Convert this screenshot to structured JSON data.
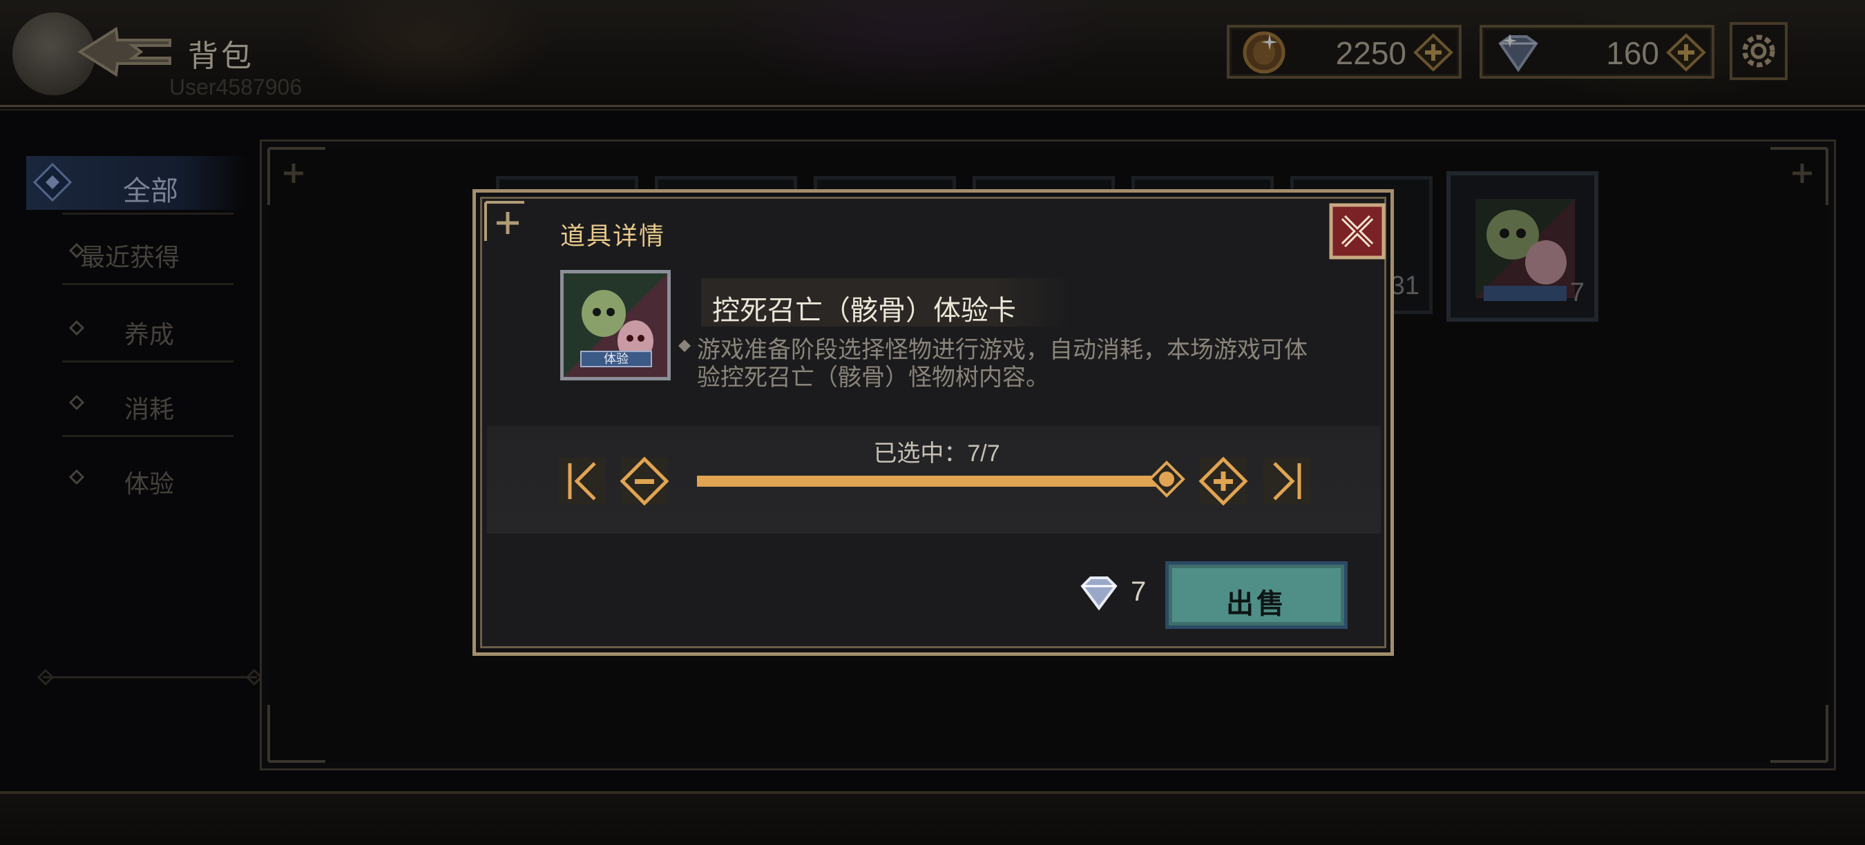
{
  "header": {
    "title": "背包",
    "user_id": "User4587906",
    "gold": "2250",
    "gems": "160"
  },
  "sidebar": {
    "active": "全部",
    "items": [
      {
        "label": "最近获得"
      },
      {
        "label": "养成"
      },
      {
        "label": "消耗"
      },
      {
        "label": "体验"
      }
    ]
  },
  "inventory": {
    "partial_count": "31",
    "visible_count": "7"
  },
  "dialog": {
    "title": "道具详情",
    "item_name": "控死召亡（骸骨）体验卡",
    "item_tag": "体验",
    "description": "游戏准备阶段选择怪物进行游戏，自动消耗，本场游戏可体验控死召亡（骸骨）怪物树内容。",
    "selected_label": "已选中：7/7",
    "selected": 7,
    "max": 7,
    "price": "7",
    "sell_label": "出售"
  },
  "colors": {
    "accent_gold": "#e0a452",
    "title_gold": "#e7c98a",
    "sell_button": "#4f8f87",
    "close_red": "#7a2226",
    "tab_active": "#2a3c5e"
  },
  "icons": [
    "back-arrow-icon",
    "gold-coin-icon",
    "gem-icon",
    "plus-icon",
    "settings-gear-icon",
    "diamond-icon",
    "close-icon",
    "skip-start-icon",
    "minus-icon",
    "skip-end-icon",
    "slider-thumb-icon"
  ]
}
